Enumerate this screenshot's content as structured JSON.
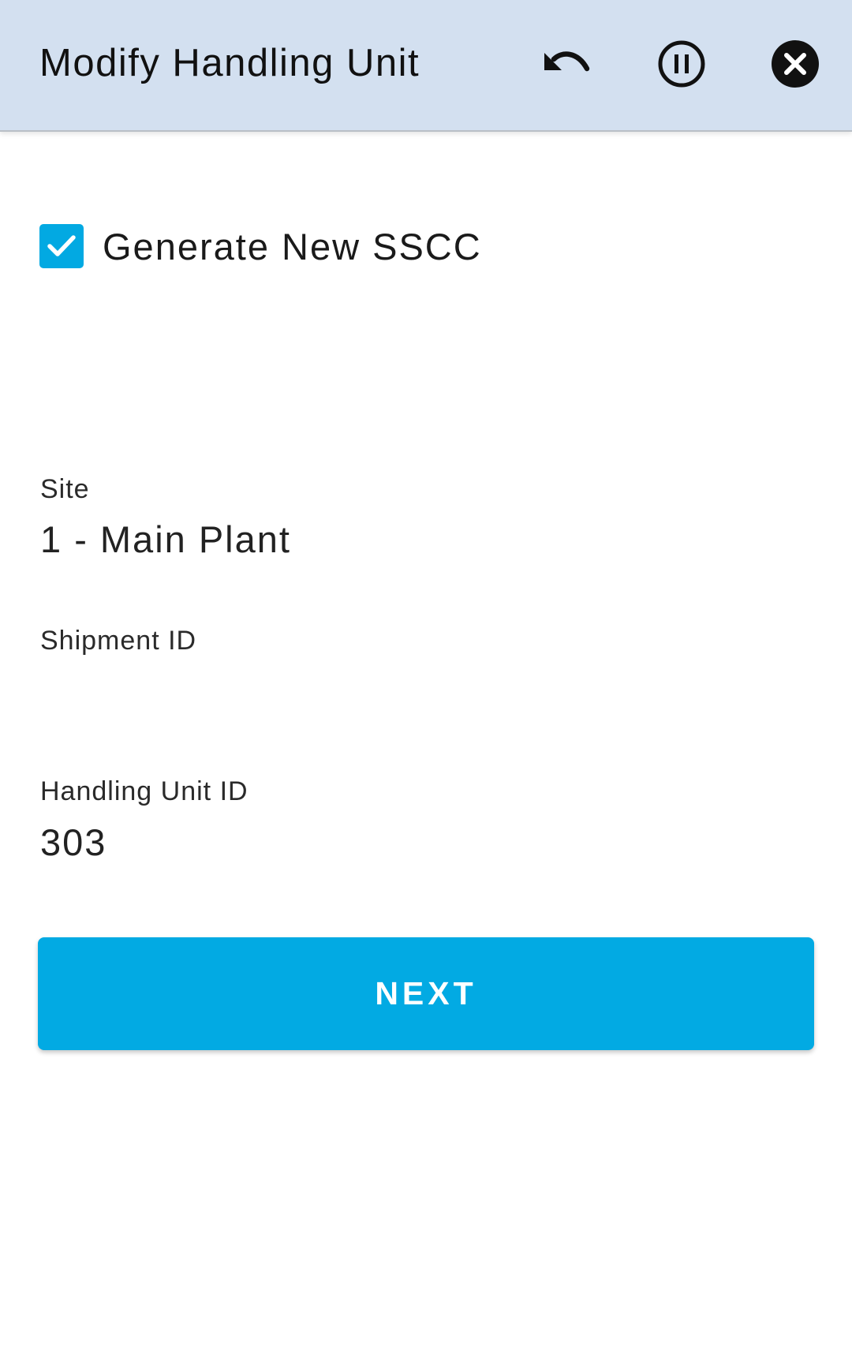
{
  "header": {
    "title": "Modify Handling Unit",
    "actions": [
      {
        "icon": "undo-icon"
      },
      {
        "icon": "pause-icon"
      },
      {
        "icon": "close-icon"
      }
    ]
  },
  "form": {
    "generate_sscc": {
      "label": "Generate New SSCC",
      "checked": true
    },
    "site": {
      "label": "Site",
      "value": "1 - Main Plant"
    },
    "shipment_id": {
      "label": "Shipment ID",
      "value": ""
    },
    "handling_unit_id": {
      "label": "Handling Unit ID",
      "value": "303"
    }
  },
  "next_button": {
    "label": "NEXT"
  },
  "colors": {
    "header_bg": "#d3e0f0",
    "accent": "#02aae3",
    "text": "#1f1f1f"
  }
}
